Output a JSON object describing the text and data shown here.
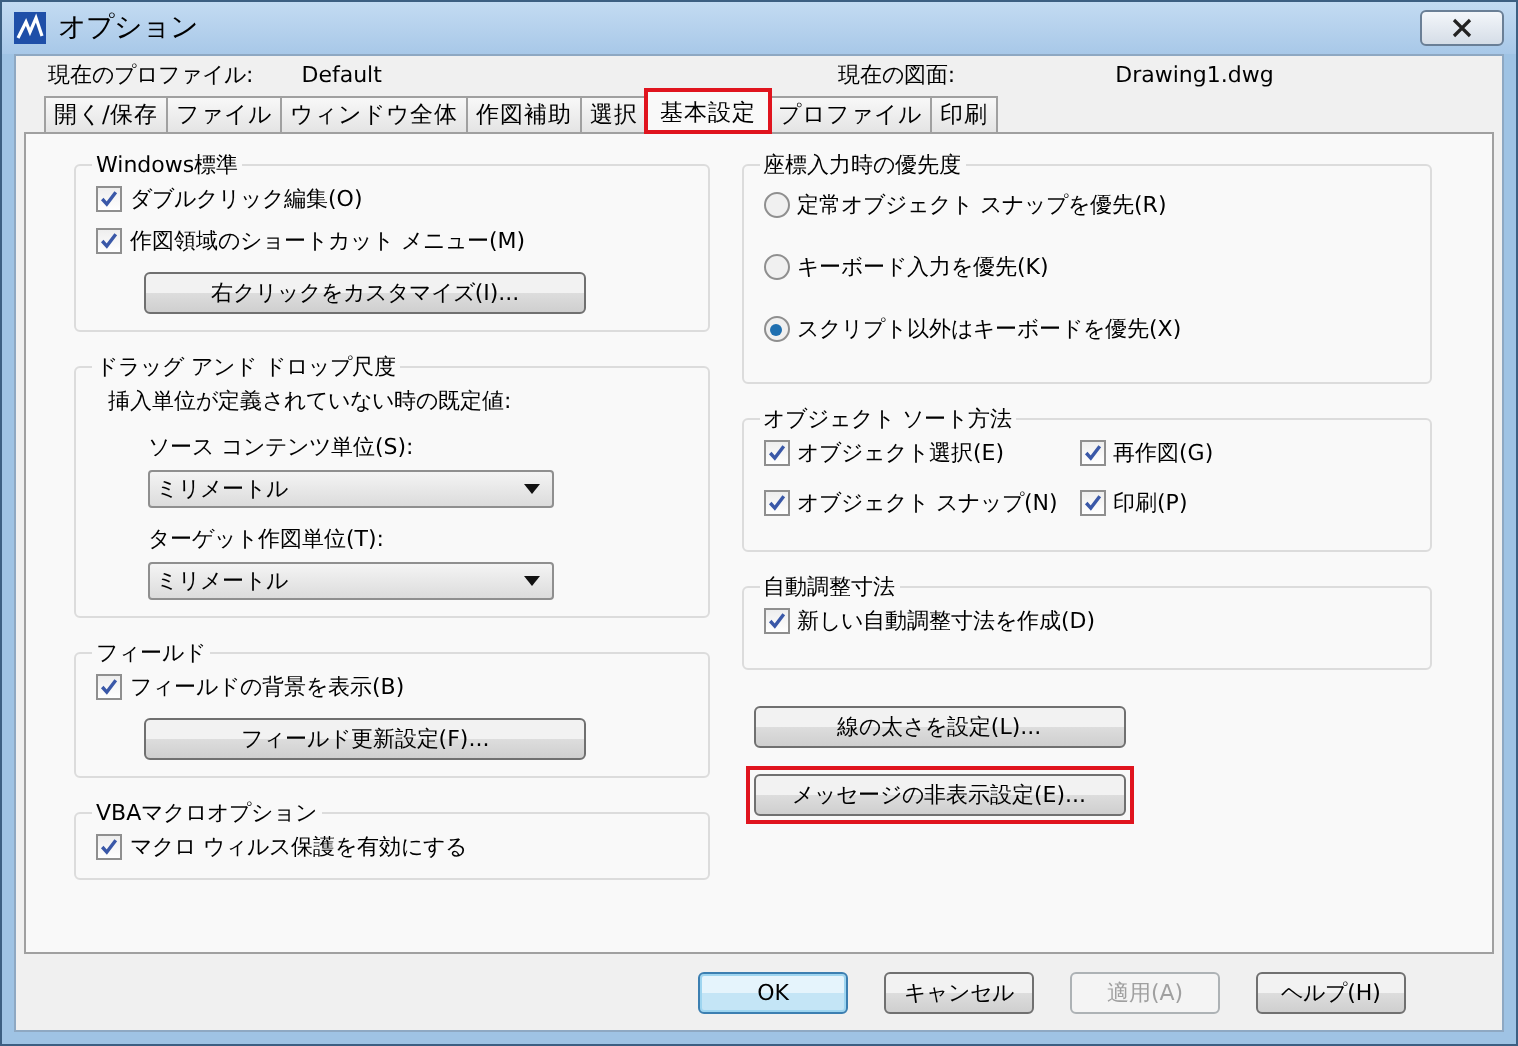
{
  "window": {
    "title": "オプション"
  },
  "profile": {
    "label": "現在のプロファイル:",
    "value": "Default"
  },
  "drawing": {
    "label": "現在の図面:",
    "value": "Drawing1.dwg"
  },
  "tabs": [
    {
      "label": "開く/保存",
      "selected": false,
      "highlighted": false
    },
    {
      "label": "ファイル",
      "selected": false,
      "highlighted": false
    },
    {
      "label": "ウィンドウ全体",
      "selected": false,
      "highlighted": false
    },
    {
      "label": "作図補助",
      "selected": false,
      "highlighted": false
    },
    {
      "label": "選択",
      "selected": false,
      "highlighted": false
    },
    {
      "label": "基本設定",
      "selected": true,
      "highlighted": true
    },
    {
      "label": "プロファイル",
      "selected": false,
      "highlighted": false
    },
    {
      "label": "印刷",
      "selected": false,
      "highlighted": false
    }
  ],
  "left_groups": [
    {
      "title": "Windows標準",
      "items": [
        {
          "kind": "checkbox",
          "label": "ダブルクリック編集(O)",
          "checked": true
        },
        {
          "kind": "checkbox",
          "label": "作図領域のショートカット メニュー(M)",
          "checked": true
        },
        {
          "kind": "button",
          "label": "右クリックをカスタマイズ(I)...",
          "highlighted": false
        }
      ]
    },
    {
      "title": "ドラッグ アンド ドロップ尺度",
      "items": [
        {
          "kind": "caption",
          "label": "挿入単位が定義されていない時の既定値:"
        },
        {
          "kind": "field_label",
          "label": "ソース コンテンツ単位(S):"
        },
        {
          "kind": "dropdown",
          "value": "ミリメートル"
        },
        {
          "kind": "field_label",
          "label": "ターゲット作図単位(T):"
        },
        {
          "kind": "dropdown",
          "value": "ミリメートル"
        }
      ]
    },
    {
      "title": "フィールド",
      "items": [
        {
          "kind": "checkbox",
          "label": "フィールドの背景を表示(B)",
          "checked": true
        },
        {
          "kind": "button",
          "label": "フィールド更新設定(F)...",
          "highlighted": false
        }
      ]
    },
    {
      "title": "VBAマクロオプション",
      "items": [
        {
          "kind": "checkbox",
          "label": "マクロ ウィルス保護を有効にする",
          "checked": true
        }
      ]
    }
  ],
  "right_groups": [
    {
      "title": "座標入力時の優先度",
      "items": [
        {
          "kind": "radio",
          "label": "定常オブジェクト スナップを優先(R)",
          "selected": false
        },
        {
          "kind": "radio",
          "label": "キーボード入力を優先(K)",
          "selected": false
        },
        {
          "kind": "radio",
          "label": "スクリプト以外はキーボードを優先(X)",
          "selected": true
        }
      ]
    },
    {
      "title": "オブジェクト ソート方法",
      "items": [
        {
          "kind": "check_row",
          "checks": [
            {
              "label": "オブジェクト選択(E)",
              "checked": true
            },
            {
              "label": "再作図(G)",
              "checked": true
            }
          ]
        },
        {
          "kind": "check_row",
          "checks": [
            {
              "label": "オブジェクト スナップ(N)",
              "checked": true
            },
            {
              "label": "印刷(P)",
              "checked": true
            }
          ]
        }
      ]
    },
    {
      "title": "自動調整寸法",
      "items": [
        {
          "kind": "checkbox",
          "label": "新しい自動調整寸法を作成(D)",
          "checked": true
        }
      ]
    }
  ],
  "right_buttons": [
    {
      "label": "線の太さを設定(L)...",
      "highlighted": false
    },
    {
      "label": "メッセージの非表示設定(E)...",
      "highlighted": true
    }
  ],
  "dialog_buttons": [
    {
      "label": "OK",
      "default": true,
      "disabled": false
    },
    {
      "label": "キャンセル",
      "default": false,
      "disabled": false
    },
    {
      "label": "適用(A)",
      "default": false,
      "disabled": true
    },
    {
      "label": "ヘルプ(H)",
      "default": false,
      "disabled": false
    }
  ]
}
